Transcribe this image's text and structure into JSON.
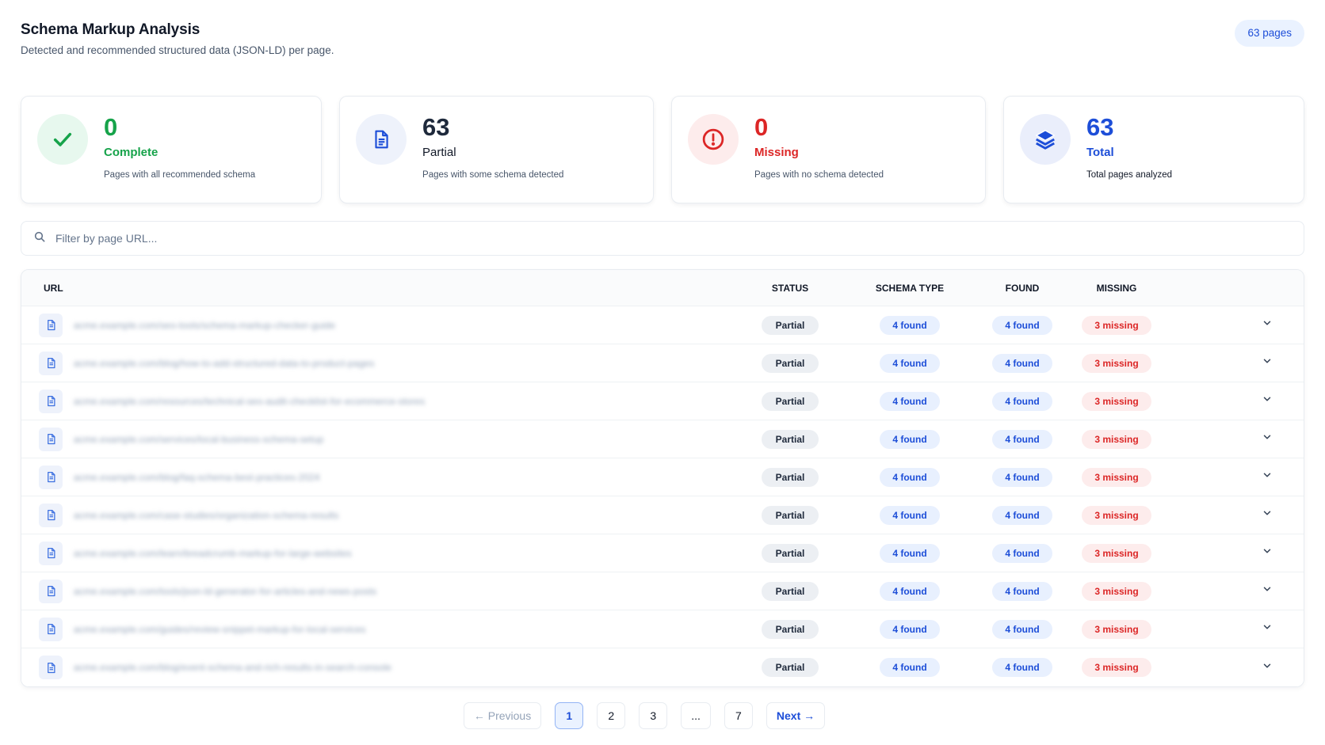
{
  "header": {
    "title": "Schema Markup Analysis",
    "subtitle": "Detected and recommended structured data (JSON-LD) per page.",
    "pages_badge": "63 pages"
  },
  "stats": [
    {
      "value": "0",
      "label": "Complete",
      "desc": "Pages with all recommended schema",
      "icon": "check-icon"
    },
    {
      "value": "63",
      "label": "Partial",
      "desc": "Pages with some schema detected",
      "icon": "document-icon"
    },
    {
      "value": "0",
      "label": "Missing",
      "desc": "Pages with no schema detected",
      "icon": "alert-circle-icon"
    },
    {
      "value": "63",
      "label": "Total",
      "desc": "Total pages analyzed",
      "icon": "layers-icon"
    }
  ],
  "search": {
    "placeholder": "Filter by page URL..."
  },
  "table": {
    "headers": {
      "url": "URL",
      "status": "STATUS",
      "schema_type": "SCHEMA TYPE",
      "found": "FOUND",
      "missing": "MISSING"
    },
    "rows": [
      {
        "url": "acme.example.com/seo-tools/schema-markup-checker-guide",
        "status": "Partial",
        "schema_type": "4 found",
        "found": "4 found",
        "missing": "3 missing"
      },
      {
        "url": "acme.example.com/blog/how-to-add-structured-data-to-product-pages",
        "status": "Partial",
        "schema_type": "4 found",
        "found": "4 found",
        "missing": "3 missing"
      },
      {
        "url": "acme.example.com/resources/technical-seo-audit-checklist-for-ecommerce-stores",
        "status": "Partial",
        "schema_type": "4 found",
        "found": "4 found",
        "missing": "3 missing"
      },
      {
        "url": "acme.example.com/services/local-business-schema-setup",
        "status": "Partial",
        "schema_type": "4 found",
        "found": "4 found",
        "missing": "3 missing"
      },
      {
        "url": "acme.example.com/blog/faq-schema-best-practices-2024",
        "status": "Partial",
        "schema_type": "4 found",
        "found": "4 found",
        "missing": "3 missing"
      },
      {
        "url": "acme.example.com/case-studies/organization-schema-results",
        "status": "Partial",
        "schema_type": "4 found",
        "found": "4 found",
        "missing": "3 missing"
      },
      {
        "url": "acme.example.com/learn/breadcrumb-markup-for-large-websites",
        "status": "Partial",
        "schema_type": "4 found",
        "found": "4 found",
        "missing": "3 missing"
      },
      {
        "url": "acme.example.com/tools/json-ld-generator-for-articles-and-news-posts",
        "status": "Partial",
        "schema_type": "4 found",
        "found": "4 found",
        "missing": "3 missing"
      },
      {
        "url": "acme.example.com/guides/review-snippet-markup-for-local-services",
        "status": "Partial",
        "schema_type": "4 found",
        "found": "4 found",
        "missing": "3 missing"
      },
      {
        "url": "acme.example.com/blog/event-schema-and-rich-results-in-search-console",
        "status": "Partial",
        "schema_type": "4 found",
        "found": "4 found",
        "missing": "3 missing"
      }
    ]
  },
  "pagination": {
    "prev": "← Previous",
    "pages": [
      "1",
      "2",
      "3",
      "...",
      "7"
    ],
    "current": "1",
    "next": "Next →"
  },
  "colors": {
    "accent": "#1d4ed8",
    "success": "#16a34a",
    "danger": "#dc2626",
    "neutral_badge": "#eceff3"
  }
}
